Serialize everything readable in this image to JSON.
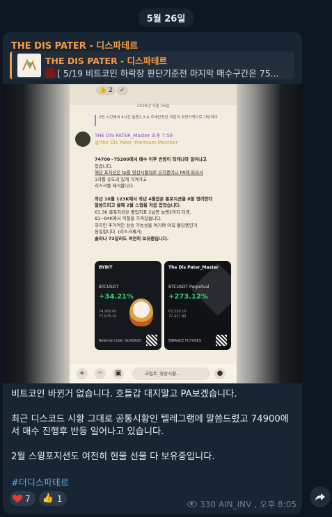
{
  "date_label": "5월 26일",
  "channel": {
    "name": "THE DIS PATER - 디스파테르"
  },
  "reply": {
    "title": "THE DIS PATER - 디스파테르",
    "text": "[ 5/19 비트코인 하락장 판단기준전 마지막 매수구간은 75...",
    "thumb_icon": "channel-logo-icon"
  },
  "photo": {
    "top_reactions": [
      "👍 2",
      "✓"
    ],
    "date": "2026년 5월 26일",
    "quote": "2번 시간에서 4시간 늘밴1,3 & 주세안정선 저항이 초반가적으로 가능하다",
    "author": "THE DIS PATER_Master  오후 7:56",
    "author_tag": "@The Dis Pater_Premium Member",
    "lines": [
      "74700~75200에서 매수 이후 반등이 작게나마 일어나고",
      "있습니다.",
      "해당 포지션은 tp를 영상시황대로 유지중이나 PA에 따라서",
      "1차를 유도리 있게 가져가고",
      "리스크를 제거합니다.",
      "",
      "작년 10월 123K에서 작년 4월잡은 롱포지션을 8할 정리한다",
      "말씀드리고 올해 2월 스윙을 처음 잡았습니다.",
      "63.3K 롱포지션은 졸업지표 2날봉 늘밴2까지 타겟,",
      "81~84K에서 익절을 가져갔습니다.",
      "하지만 추가적인 상승 가능성을 여기며 아직 홀딩중인거",
      "동일합니다. (리스크제거)",
      "솔라나 72달러도 여전히 보유중입니다."
    ],
    "card_left": {
      "logo": "BYBIT",
      "pair": "BTCUSDT",
      "pct": "+34.21%",
      "rows": [
        "74,900.00",
        "77,675.10"
      ],
      "ref": "Referral Code: GL43XVD"
    },
    "card_right": {
      "logo": "The Dis Pater_Master",
      "pair": "BTCUSDT Perpetual",
      "pct": "+273.12%",
      "rows": [
        "63,320.10",
        "77,427.80"
      ],
      "ref": "BINANCE FUTURES"
    },
    "input_text": "크립토_영상시황..."
  },
  "message": {
    "paragraphs": [
      "비트코인 바뀐거 없습니다. 호들갑 대지말고 PA보겠습니다.",
      "최근 디스코드 시황 그대로 공통시황인 텔레그램에 말씀드렸고 74900에서 매수 진행후 반등 일어나고 있습니다.",
      "2월 스윙포지션도 여전히 현물 선물 다 보유중입니다."
    ],
    "hashtag": "#더디스파테르"
  },
  "reactions": [
    {
      "emoji": "heart-icon",
      "count": "7"
    },
    {
      "emoji": "thumbs-up-icon",
      "count": "1"
    }
  ],
  "meta": {
    "views": "330",
    "author": "AIN_INV",
    "time": "오후 8:05"
  },
  "colors": {
    "accent": "#f79c45",
    "link": "#5ea8e8",
    "bubble": "#182533",
    "background": "#0e1621"
  }
}
